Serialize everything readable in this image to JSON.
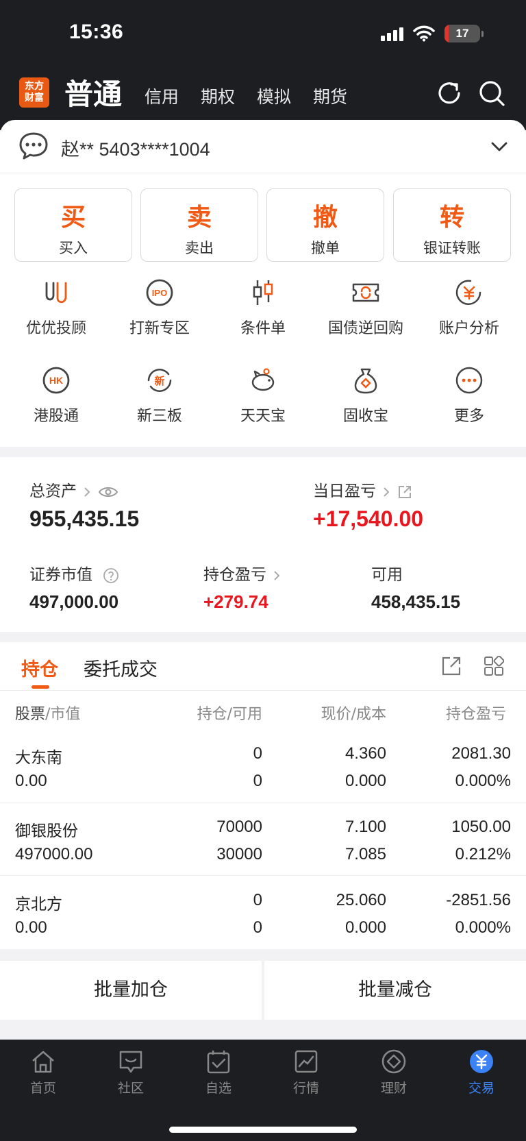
{
  "status_bar": {
    "time": "15:36",
    "battery": "17"
  },
  "header": {
    "logo": [
      "东方",
      "财富"
    ],
    "active_tab": "普通",
    "tabs": [
      "信用",
      "期权",
      "模拟",
      "期货"
    ]
  },
  "account": {
    "text": "赵** 5403****1004"
  },
  "actions": [
    {
      "big": "买",
      "label": "买入"
    },
    {
      "big": "卖",
      "label": "卖出"
    },
    {
      "big": "撤",
      "label": "撤单"
    },
    {
      "big": "转",
      "label": "银证转账"
    }
  ],
  "grid": [
    {
      "label": "优优投顾",
      "icon": "uu-icon"
    },
    {
      "label": "打新专区",
      "icon": "ipo-icon"
    },
    {
      "label": "条件单",
      "icon": "candlestick-icon"
    },
    {
      "label": "国债逆回购",
      "icon": "ticket-refresh-icon"
    },
    {
      "label": "账户分析",
      "icon": "yuan-chart-icon"
    },
    {
      "label": "港股通",
      "icon": "hk-icon"
    },
    {
      "label": "新三板",
      "icon": "new-board-icon"
    },
    {
      "label": "天天宝",
      "icon": "piggy-bank-icon"
    },
    {
      "label": "固收宝",
      "icon": "money-bag-icon"
    },
    {
      "label": "更多",
      "icon": "more-icon"
    }
  ],
  "assets": {
    "total_label": "总资产",
    "total_value": "955,435.15",
    "daily_pl_label": "当日盈亏",
    "daily_pl_value": "+17,540.00",
    "market_value_label": "证券市值",
    "market_value": "497,000.00",
    "position_pl_label": "持仓盈亏",
    "position_pl_value": "+279.74",
    "available_label": "可用",
    "available_value": "458,435.15"
  },
  "holdings": {
    "tabs": [
      "持仓",
      "委托成交"
    ],
    "headers": {
      "c1a": "股票",
      "c1b": "/市值",
      "c2a": "持仓",
      "c2b": "/可用",
      "c3a": "现价",
      "c3b": "/成本",
      "c4": "持仓盈亏"
    },
    "rows": [
      {
        "name": "大东南",
        "mv": "0.00",
        "pos": "0",
        "avail": "0",
        "price": "4.360",
        "cost": "0.000",
        "pl": "2081.30",
        "pct": "0.000%",
        "color": "red"
      },
      {
        "name": "御银股份",
        "mv": "497000.00",
        "pos": "70000",
        "avail": "30000",
        "price": "7.100",
        "cost": "7.085",
        "pl": "1050.00",
        "pct": "0.212%",
        "color": "red"
      },
      {
        "name": "京北方",
        "mv": "0.00",
        "pos": "0",
        "avail": "0",
        "price": "25.060",
        "cost": "0.000",
        "pl": "-2851.56",
        "pct": "0.000%",
        "color": "green"
      }
    ]
  },
  "batch": {
    "add": "批量加仓",
    "reduce": "批量减仓"
  },
  "nav": [
    {
      "label": "首页",
      "icon": "home-icon"
    },
    {
      "label": "社区",
      "icon": "community-icon"
    },
    {
      "label": "自选",
      "icon": "watchlist-icon"
    },
    {
      "label": "行情",
      "icon": "market-icon"
    },
    {
      "label": "理财",
      "icon": "wealth-icon"
    },
    {
      "label": "交易",
      "icon": "trade-icon",
      "active": true
    }
  ],
  "colors": {
    "accent": "#f05a14",
    "up": "#e8171f",
    "down": "#2ea121",
    "nav_active": "#3b82f6"
  }
}
